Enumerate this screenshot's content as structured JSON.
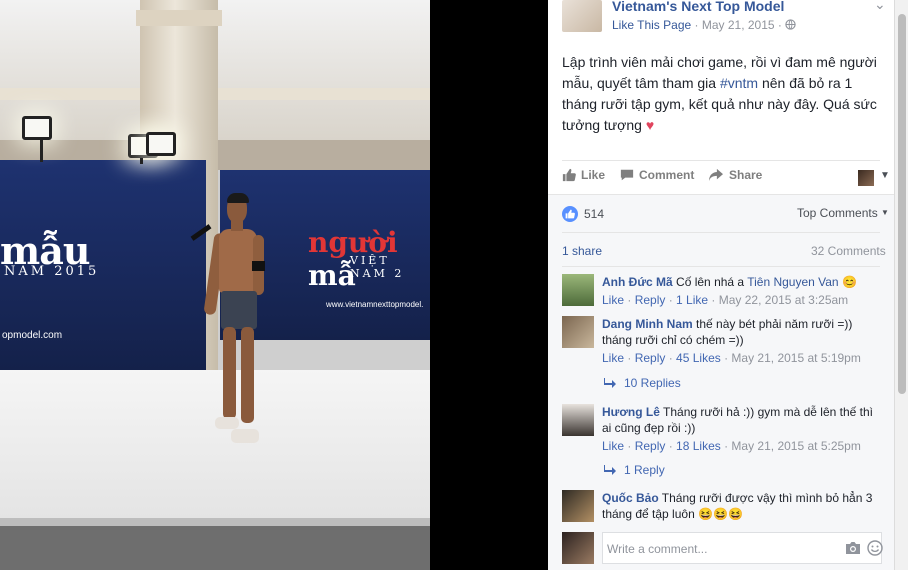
{
  "photo": {
    "banner_left_big": "mẫu",
    "banner_left_small": "NAM 2015",
    "banner_left_url": "opmodel.com",
    "banner_right_big_red": "người",
    "banner_right_big_white": " mẫ",
    "banner_right_small": "VIỆT NAM 2",
    "banner_right_url": "www.vietnamnexttopmodel."
  },
  "post": {
    "page_name": "Vietnam's Next Top Model",
    "like_page": "Like This Page",
    "date": "May 21, 2015",
    "text_before_tag": "Lập trình viên mải chơi game, rồi vì đam mê người mẫu, quyết tâm tham gia ",
    "hashtag": "#vntm",
    "text_after_tag": " nên đã bỏ ra 1 tháng rưỡi tập gym, kết quả như này đây. Quá sức tưởng tượng ",
    "heart": "♥"
  },
  "actions": {
    "like": "Like",
    "comment": "Comment",
    "share": "Share"
  },
  "stats": {
    "likes": "514",
    "top_comments": "Top Comments",
    "shares": "1 share",
    "comments": "32 Comments"
  },
  "comments": [
    {
      "name": "Anh Đức Mã",
      "text": "Cố lên nhá a ",
      "tag": "Tiên Nguyen Van",
      "emoji": "😊",
      "like": "Like",
      "reply": "Reply",
      "likes": "1 Like",
      "time": "May 22, 2015 at 3:25am"
    },
    {
      "name": "Dang Minh Nam",
      "text": "thế này bét phải năm rưỡi =)) tháng rưỡi chỉ có chém =))",
      "like": "Like",
      "reply": "Reply",
      "likes": "45 Likes",
      "time": "May 21, 2015 at 5:19pm",
      "replies": "10 Replies"
    },
    {
      "name": "Hương Lê",
      "text": "Tháng rưỡi hả :)) gym mà dễ lên thế thì ai cũng đẹp rồi :))",
      "like": "Like",
      "reply": "Reply",
      "likes": "18 Likes",
      "time": "May 21, 2015 at 5:25pm",
      "replies": "1 Reply"
    },
    {
      "name": "Quốc Bảo",
      "text": "Tháng rưỡi được vậy thì mình bỏ hẳn 3 tháng để tập luôn ",
      "emoji": "😆😆😆"
    }
  ],
  "composer": {
    "placeholder": "Write a comment..."
  },
  "colors": {
    "link": "#365899",
    "muted": "#90949c",
    "like_blue": "#5890ff",
    "heart": "#e0445d"
  }
}
